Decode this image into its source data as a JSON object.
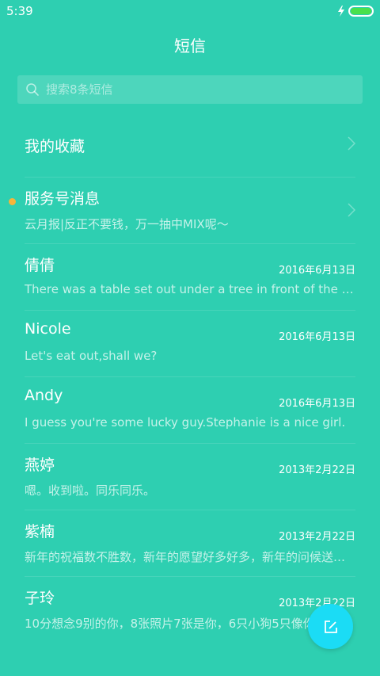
{
  "status": {
    "time": "5:39"
  },
  "header": {
    "title": "短信"
  },
  "search": {
    "placeholder": "搜索8条短信"
  },
  "favorites": {
    "label": "我的收藏"
  },
  "service": {
    "title": "服务号消息",
    "snippet": "云月报|反正不要钱，万一抽中MIX呢～"
  },
  "conversations": [
    {
      "name": "倩倩",
      "date": "2016年6月13日",
      "snippet": "There was a table set out under a tree in front of the house, and the March Hare and the Hatter were having tea at it"
    },
    {
      "name": "Nicole",
      "date": "2016年6月13日",
      "snippet": "Let's eat out,shall we?"
    },
    {
      "name": "Andy",
      "date": "2016年6月13日",
      "snippet": "I guess you're some lucky guy.Stephanie is a nice girl."
    },
    {
      "name": "燕婷",
      "date": "2013年2月22日",
      "snippet": "嗯。收到啦。同乐同乐。"
    },
    {
      "name": "紫楠",
      "date": "2013年2月22日",
      "snippet": "新年的祝福数不胜数，新年的愿望好多好多，新年的问候送给你"
    },
    {
      "name": "子玲",
      "date": "2013年2月22日",
      "snippet": "10分想念9别的你，8张照片7张是你，6只小狗5只像你"
    }
  ],
  "colors": {
    "background": "#2ecfb1",
    "accent": "#1bdcf5",
    "unread": "#f6b53a",
    "battery": "#49e04c"
  },
  "icons": {
    "search": "search-icon",
    "chevron": "chevron-right-icon",
    "compose": "compose-icon",
    "charging": "bolt-icon",
    "battery": "battery-icon"
  }
}
